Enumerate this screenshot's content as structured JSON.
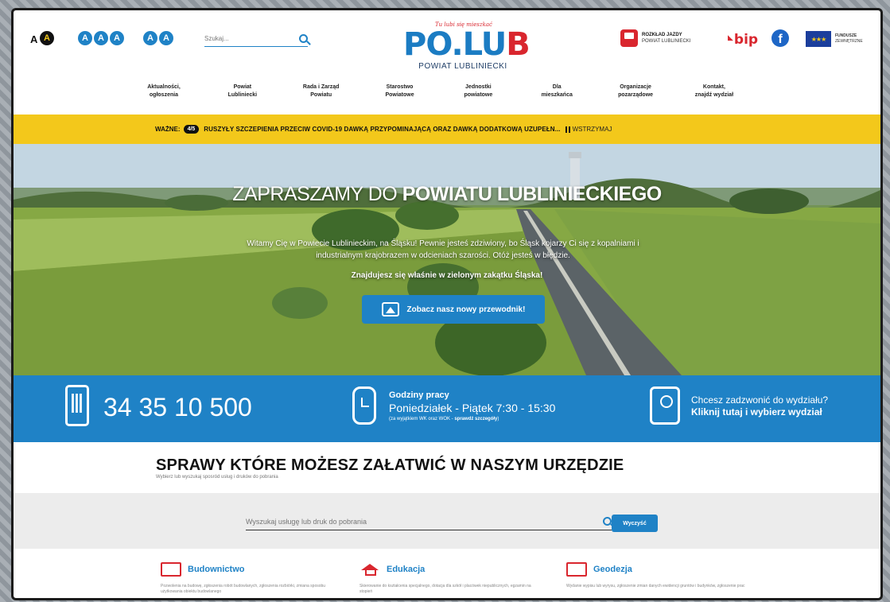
{
  "header": {
    "access": {
      "a_small": "A",
      "a_dark": "A",
      "a_blue": [
        "A",
        "A",
        "A"
      ],
      "contrast": [
        "A",
        "A"
      ]
    },
    "search_placeholder": "Szukaj...",
    "logo": {
      "tagline": "Tu lubi się mieszkać",
      "main_blue": "PO.LU",
      "main_red": "B",
      "sub": "POWIAT LUBLINIECKI"
    },
    "bus": {
      "title": "ROZKŁAD JAZDY",
      "sub": "POWIAT LUBLINIECKI"
    },
    "bip": "bip",
    "facebook": "f",
    "eu": {
      "title": "FUNDUSZE",
      "sub": "ZEWNĘTRZNE"
    }
  },
  "nav": [
    "Aktualności,\nogłoszenia",
    "Powiat\nLubliniecki",
    "Rada i Zarząd\nPowiatu",
    "Starostwo\nPowiatowe",
    "Jednostki\npowiatowe",
    "Dla\nmieszkańca",
    "Organizacje\npozarządowe",
    "Kontakt,\nznajdź wydział"
  ],
  "alert": {
    "label": "WAŻNE:",
    "counter": "4/5",
    "text": "RUSZYŁY SZCZEPIENIA PRZECIW COVID-19 DAWKĄ PRZYPOMINAJĄCĄ ORAZ DAWKĄ DODATKOWĄ UZUPEŁN...",
    "pause": "WSTRZYMAJ"
  },
  "hero": {
    "title_light": "ZAPRASZAMY DO ",
    "title_bold": "POWIATU LUBLINIECKIEGO",
    "desc": "Witamy Cię w Powiecie Lublinieckim, na Śląsku! Pewnie jesteś zdziwiony, bo Śląsk kojarzy Ci się z kopalniami i industrialnym krajobrazem w odcieniach szarości. Otóż jesteś w błędzie.",
    "emphasis": "Znajdujesz się właśnie w zielonym zakątku Śląska!",
    "button": "Zobacz nasz nowy przewodnik!"
  },
  "contact": {
    "phone": "34 35 10 500",
    "hours_title": "Godziny pracy",
    "hours": "Poniedziałek - Piątek 7:30 - 15:30",
    "hours_note": "(za wyjątkiem WK oraz WOK - ",
    "hours_note_link": "sprawdź szczegóły",
    "hours_note_end": ")",
    "call_q": "Chcesz zadzwonić do wydziału?",
    "call_link": "Kliknij tutaj i wybierz wydział"
  },
  "services": {
    "title": "SPRAWY KTÓRE MOŻESZ ZAŁATWIĆ W NASZYM URZĘDZIE",
    "subtitle": "Wybierz lub wyszukaj sposród usług i druków do pobrania",
    "search_placeholder": "Wyszukaj usługę lub druk do pobrania",
    "clear_button": "Wyczyść",
    "categories": [
      {
        "name": "Budownictwo",
        "desc": "Pozwolenia na budowę, zgłoszenia robót budowlanych, zgłoszenia rozbiórki, zmiana sposobu użytkowania obiektu budowlanego"
      },
      {
        "name": "Edukacja",
        "desc": "Skierowanie do kształcenia specjalnego, dotacja dla szkół i placówek niepublicznych, egzamin na stopień"
      },
      {
        "name": "Geodezja",
        "desc": "Wydanie wypisu lub wyrysu, zgłoszenie zmian danych ewidencji gruntów i budynków, zgłoszenie prac"
      }
    ]
  },
  "colors": {
    "accent": "#1f82c6",
    "alert": "#f3c81b",
    "brand_red": "#d9262e"
  }
}
